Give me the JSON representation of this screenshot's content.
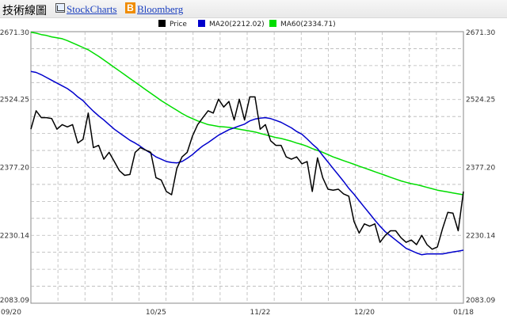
{
  "toolbar": {
    "title": "技術線圖",
    "stockcharts_label": "StockCharts",
    "bloomberg_label": "Bloomberg",
    "bloomberg_icon": "bloomberg-b-icon",
    "stockcharts_icon": "chart-icon"
  },
  "chart_data": {
    "type": "line",
    "ylim": [
      2083.09,
      2671.3
    ],
    "grid": true,
    "legend_position": "top",
    "y_ticks": [
      "2671.30",
      "2524.25",
      "2377.20",
      "2230.14",
      "2083.09"
    ],
    "y_tick_values": [
      2671.3,
      2524.25,
      2377.2,
      2230.14,
      2083.09
    ],
    "x_ticks": [
      {
        "label": "09/20",
        "index": 0
      },
      {
        "label": "10/25",
        "index": 24
      },
      {
        "label": "11/22",
        "index": 44
      },
      {
        "label": "12/20",
        "index": 64
      },
      {
        "label": "01/18",
        "index": 83
      }
    ],
    "n_points": 84,
    "series": [
      {
        "name": "Price",
        "legend": "Price",
        "color": "#000000",
        "values": [
          2460,
          2500,
          2485,
          2485,
          2483,
          2460,
          2470,
          2465,
          2470,
          2430,
          2438,
          2495,
          2420,
          2425,
          2395,
          2410,
          2390,
          2370,
          2360,
          2362,
          2410,
          2420,
          2415,
          2410,
          2355,
          2350,
          2325,
          2318,
          2375,
          2400,
          2410,
          2445,
          2470,
          2485,
          2500,
          2495,
          2525,
          2508,
          2520,
          2480,
          2525,
          2480,
          2530,
          2530,
          2460,
          2470,
          2435,
          2425,
          2425,
          2400,
          2395,
          2400,
          2385,
          2390,
          2325,
          2398,
          2355,
          2330,
          2328,
          2330,
          2320,
          2315,
          2260,
          2235,
          2255,
          2250,
          2255,
          2215,
          2230,
          2240,
          2240,
          2225,
          2215,
          2220,
          2210,
          2230,
          2210,
          2200,
          2205,
          2245,
          2280,
          2278,
          2240,
          2325
        ]
      },
      {
        "name": "MA20",
        "legend": "MA20(2212.02)",
        "color": "#0000cc",
        "values": [
          2585,
          2583,
          2578,
          2572,
          2566,
          2560,
          2554,
          2548,
          2540,
          2530,
          2522,
          2510,
          2499,
          2489,
          2480,
          2470,
          2460,
          2452,
          2444,
          2436,
          2430,
          2423,
          2415,
          2408,
          2400,
          2395,
          2390,
          2388,
          2387,
          2390,
          2397,
          2405,
          2415,
          2424,
          2431,
          2439,
          2447,
          2453,
          2459,
          2463,
          2467,
          2471,
          2478,
          2482,
          2484,
          2485,
          2483,
          2479,
          2475,
          2469,
          2463,
          2455,
          2449,
          2439,
          2428,
          2418,
          2403,
          2389,
          2375,
          2361,
          2347,
          2332,
          2319,
          2305,
          2291,
          2277,
          2263,
          2250,
          2238,
          2229,
          2220,
          2211,
          2202,
          2197,
          2192,
          2188,
          2190,
          2190,
          2190,
          2190,
          2192,
          2194,
          2196,
          2198
        ]
      },
      {
        "name": "MA60",
        "legend": "MA60(2334.71)",
        "color": "#00dd00",
        "values": [
          2670,
          2668,
          2665,
          2663,
          2660,
          2658,
          2656,
          2652,
          2647,
          2642,
          2637,
          2632,
          2625,
          2618,
          2610,
          2602,
          2594,
          2586,
          2578,
          2570,
          2562,
          2554,
          2546,
          2538,
          2530,
          2522,
          2515,
          2508,
          2501,
          2494,
          2488,
          2483,
          2478,
          2474,
          2470,
          2468,
          2466,
          2465,
          2464,
          2462,
          2460,
          2458,
          2456,
          2454,
          2451,
          2448,
          2445,
          2442,
          2440,
          2437,
          2434,
          2430,
          2427,
          2423,
          2418,
          2414,
          2410,
          2405,
          2400,
          2396,
          2392,
          2388,
          2384,
          2380,
          2376,
          2372,
          2368,
          2364,
          2360,
          2356,
          2352,
          2348,
          2345,
          2342,
          2340,
          2337,
          2334,
          2331,
          2328,
          2326,
          2324,
          2322,
          2320,
          2318
        ]
      }
    ]
  }
}
